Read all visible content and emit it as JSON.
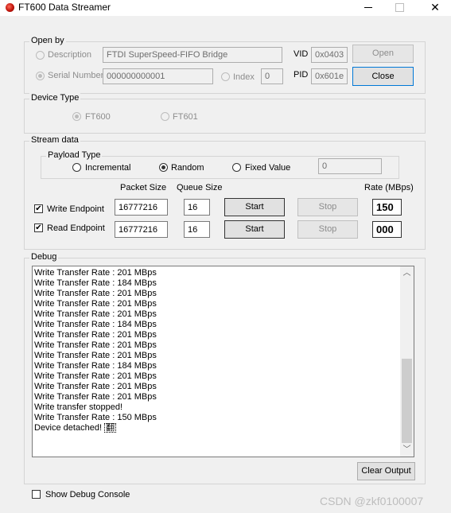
{
  "window": {
    "title": "FT600 Data Streamer"
  },
  "open_by": {
    "group_title": "Open by",
    "description_label": "Description",
    "description_value": "FTDI SuperSpeed-FIFO Bridge",
    "serial_label": "Serial Number",
    "serial_value": "000000000001",
    "index_label": "Index",
    "index_value": "0",
    "vid_label": "VID",
    "vid_value": "0x0403",
    "pid_label": "PID",
    "pid_value": "0x601e",
    "open_button": "Open",
    "close_button": "Close"
  },
  "device_type": {
    "group_title": "Device Type",
    "option_ft600": "FT600",
    "option_ft601": "FT601"
  },
  "stream_data": {
    "group_title": "Stream data",
    "payload_type": {
      "title": "Payload Type",
      "incremental": "Incremental",
      "random": "Random",
      "fixed": "Fixed Value",
      "fixed_value": "0"
    },
    "headers": {
      "packet_size": "Packet Size",
      "queue_size": "Queue Size",
      "rate": "Rate (MBps)"
    },
    "write": {
      "label": "Write Endpoint",
      "checked": true,
      "packet_size": "16777216",
      "queue_size": "16",
      "start": "Start",
      "stop": "Stop",
      "rate": "150"
    },
    "read": {
      "label": "Read Endpoint",
      "checked": true,
      "packet_size": "16777216",
      "queue_size": "16",
      "start": "Start",
      "stop": "Stop",
      "rate": "000"
    }
  },
  "debug": {
    "group_title": "Debug",
    "lines": [
      "Write Transfer Rate : 201 MBps",
      "Write Transfer Rate : 184 MBps",
      "Write Transfer Rate : 201 MBps",
      "Write Transfer Rate : 201 MBps",
      "Write Transfer Rate : 201 MBps",
      "Write Transfer Rate : 184 MBps",
      "Write Transfer Rate : 201 MBps",
      "Write Transfer Rate : 201 MBps",
      "Write Transfer Rate : 201 MBps",
      "Write Transfer Rate : 184 MBps",
      "Write Transfer Rate : 201 MBps",
      "Write Transfer Rate : 201 MBps",
      "Write Transfer Rate : 201 MBps",
      "Write transfer stopped!",
      "Write Transfer Rate : 150 MBps"
    ],
    "last_line_text": "Device detached!",
    "last_line_glyph": "翻",
    "clear_button": "Clear Output"
  },
  "show_debug_console": {
    "label": "Show Debug Console",
    "checked": false
  },
  "watermark": "CSDN @zkf0100007"
}
